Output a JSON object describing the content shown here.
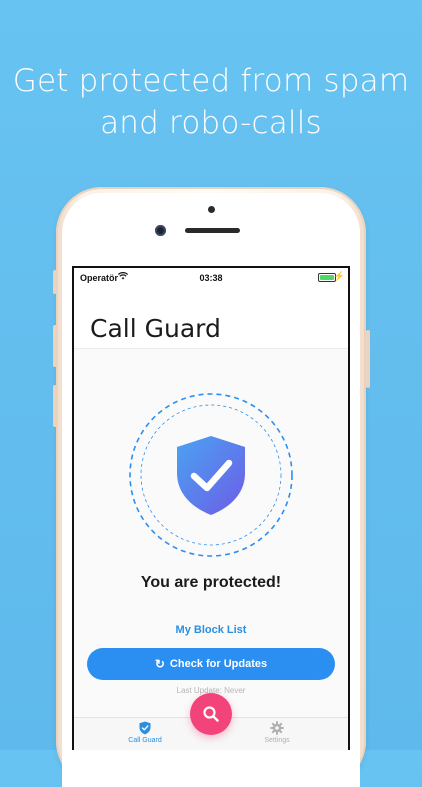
{
  "headline": {
    "line1": "Get protected from spam",
    "line2": "and robo-calls"
  },
  "status_bar": {
    "carrier": "Operatör",
    "time": "03:38"
  },
  "app": {
    "title": "Call Guard",
    "status_message": "You are protected!",
    "block_list_link": "My Block List",
    "check_updates_label": "Check for Updates",
    "last_update": "Last Update: Never"
  },
  "tab_bar": {
    "tabs": [
      {
        "label": "Call Guard",
        "icon": "shield-check-icon",
        "active": true
      },
      {
        "label": "Settings",
        "icon": "gear-icon",
        "active": false
      }
    ],
    "center_button_icon": "search-icon"
  },
  "colors": {
    "background": "#67c3f1",
    "accent": "#2b8ff2",
    "fab": "#f2447b",
    "shield_top": "#4a9ef0",
    "shield_bottom": "#6a5ee8"
  }
}
